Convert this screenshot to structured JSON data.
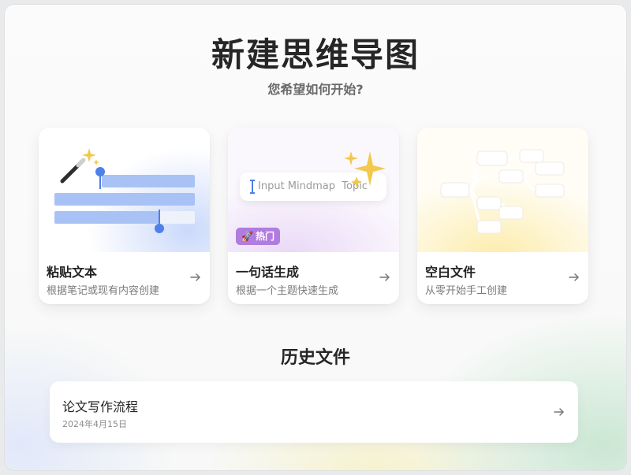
{
  "header": {
    "title": "新建思维导图",
    "subtitle": "您希望如何开始?"
  },
  "cards": [
    {
      "title": "粘贴文本",
      "description": "根据笔记或现有内容创建",
      "icon": "magic-wand-icon"
    },
    {
      "title": "一句话生成",
      "description": "根据一个主题快速生成",
      "input_placeholder": "Input Mindmap  Topic",
      "badge": "热门",
      "badge_icon": "rocket-icon",
      "badge_color": "#b07ce0"
    },
    {
      "title": "空白文件",
      "description": "从零开始手工创建"
    }
  ],
  "history": {
    "section_title": "历史文件",
    "items": [
      {
        "name": "论文写作流程",
        "date": "2024年4月15日"
      }
    ]
  },
  "colors": {
    "accent_blue": "#4f7fe8",
    "badge_purple": "#b07ce0",
    "sparkle_gold": "#f2c94c"
  }
}
